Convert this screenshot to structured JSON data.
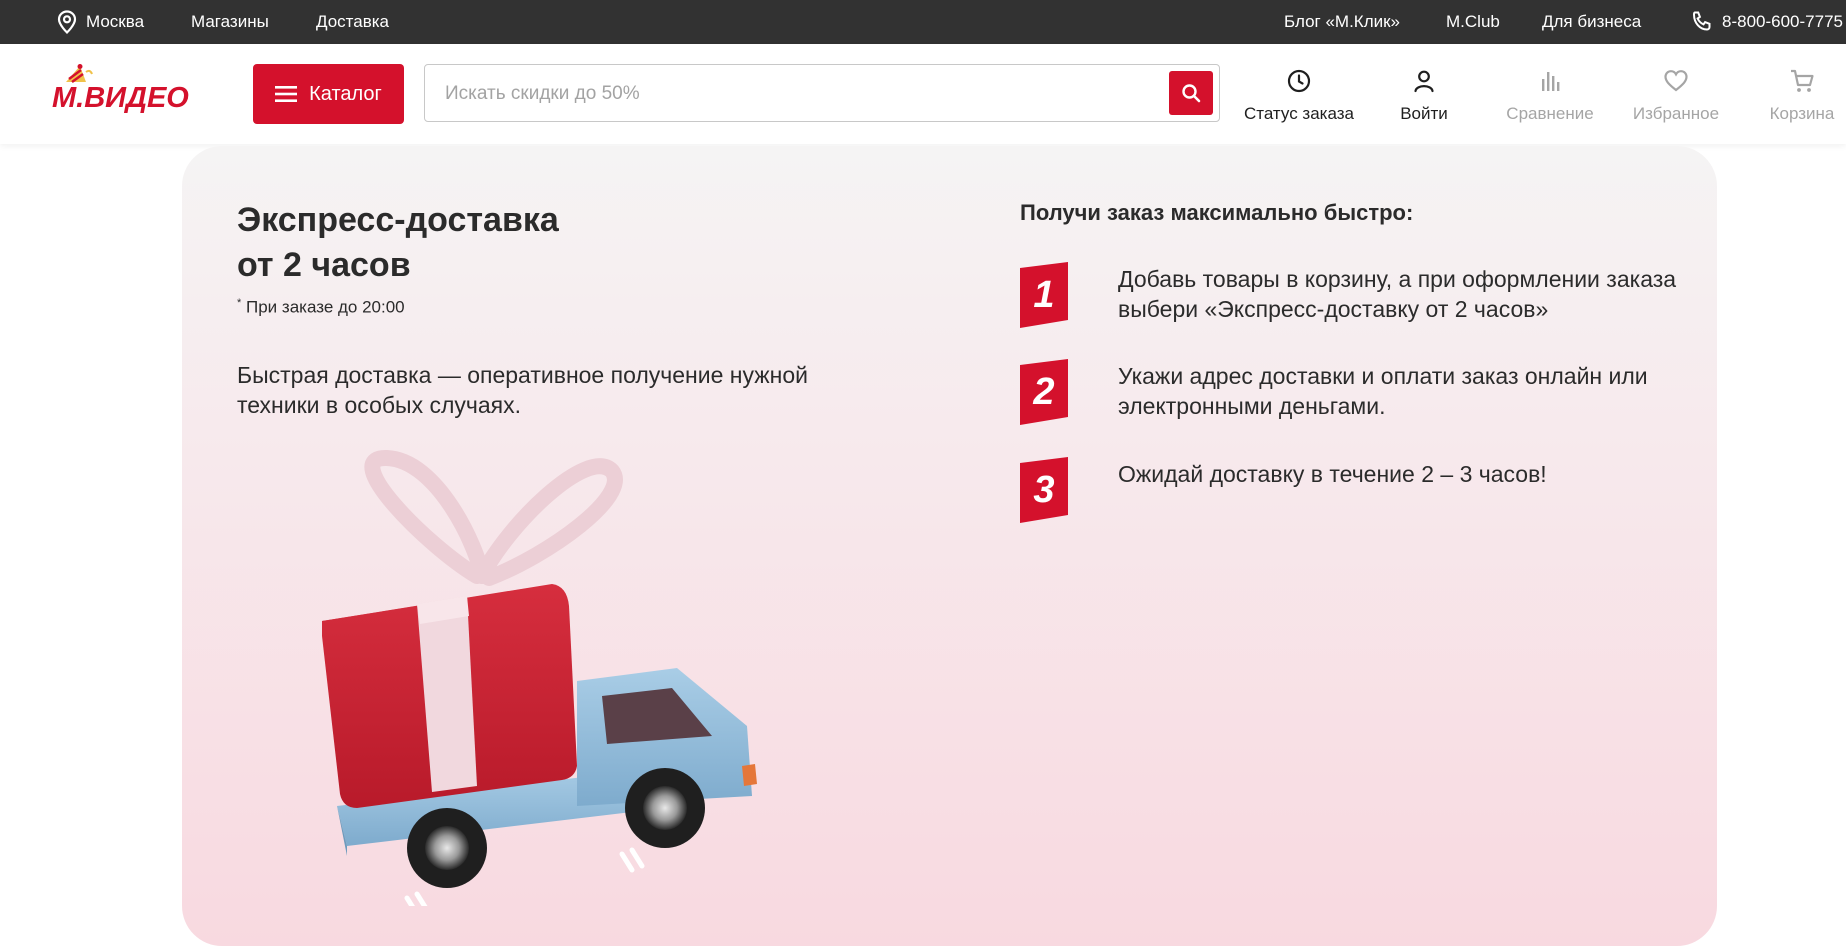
{
  "topbar": {
    "city": "Москва",
    "stores": "Магазины",
    "delivery": "Доставка",
    "blog": "Блог «М.Клик»",
    "club": "M.Club",
    "business": "Для бизнеса",
    "phone": "8-800-600-7775"
  },
  "header": {
    "logo_text": "М.ВИДЕО",
    "catalog_label": "Каталог",
    "search_placeholder": "Искать скидки до 50%",
    "actions": {
      "order_status": "Статус заказа",
      "login": "Войти",
      "compare": "Сравнение",
      "favorites": "Избранное",
      "cart": "Корзина"
    }
  },
  "promo": {
    "title_line1": "Экспресс-доставка",
    "title_line2": "от 2 часов",
    "note_mark": "*",
    "note": " При заказе до 20:00",
    "description": "Быстрая доставка — оперативное получение нужной техники в особых случаях.",
    "steps_title": "Получи заказ максимально быстро:",
    "steps": [
      {
        "number": "1",
        "text": "Добавь товары в корзину, а при оформлении заказа выбери «Экспресс-доставку от 2 часов»"
      },
      {
        "number": "2",
        "text": "Укажи адрес доставки и оплати заказ онлайн или электронными деньгами."
      },
      {
        "number": "3",
        "text": "Ожидай доставку в течение 2 – 3 часов!"
      }
    ]
  },
  "colors": {
    "brand_red": "#d4112c",
    "topbar_bg": "#323232",
    "muted_text": "#a5a5a5"
  }
}
